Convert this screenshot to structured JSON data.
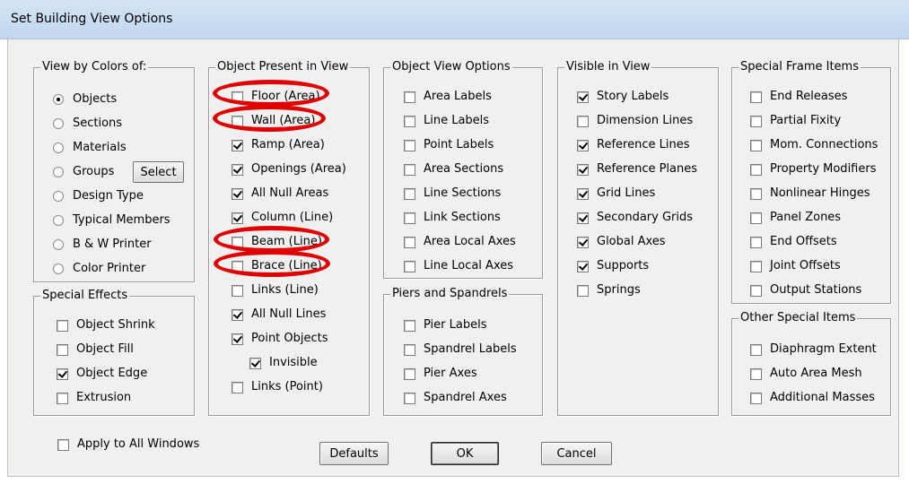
{
  "window": {
    "title": "Set Building View Options"
  },
  "view_by_colors": {
    "title": "View by Colors of:",
    "options": [
      {
        "label": "Objects",
        "selected": true
      },
      {
        "label": "Sections",
        "selected": false
      },
      {
        "label": "Materials",
        "selected": false
      },
      {
        "label": "Groups",
        "selected": false
      },
      {
        "label": "Design Type",
        "selected": false
      },
      {
        "label": "Typical Members",
        "selected": false
      },
      {
        "label": "B & W Printer",
        "selected": false
      },
      {
        "label": "Color Printer",
        "selected": false
      }
    ],
    "select_label": "Select"
  },
  "special_effects": {
    "title": "Special Effects",
    "items": [
      {
        "label": "Object Shrink",
        "checked": false
      },
      {
        "label": "Object Fill",
        "checked": false
      },
      {
        "label": "Object Edge",
        "checked": true
      },
      {
        "label": "Extrusion",
        "checked": false
      }
    ]
  },
  "object_present": {
    "title": "Object Present in View",
    "items": [
      {
        "label": "Floor (Area)",
        "checked": false,
        "circled": true
      },
      {
        "label": "Wall (Area)",
        "checked": false,
        "circled": true
      },
      {
        "label": "Ramp (Area)",
        "checked": true,
        "circled": false
      },
      {
        "label": "Openings (Area)",
        "checked": true,
        "circled": false
      },
      {
        "label": "All Null Areas",
        "checked": true,
        "circled": false
      },
      {
        "label": "Column (Line)",
        "checked": true,
        "circled": false
      },
      {
        "label": "Beam (Line)",
        "checked": false,
        "circled": true
      },
      {
        "label": "Brace (Line)",
        "checked": false,
        "circled": true
      },
      {
        "label": "Links (Line)",
        "checked": false,
        "circled": false
      },
      {
        "label": "All Null Lines",
        "checked": true,
        "circled": false
      },
      {
        "label": "Point Objects",
        "checked": true,
        "circled": false
      },
      {
        "label": "Invisible",
        "checked": true,
        "circled": false,
        "indent": true
      },
      {
        "label": "Links (Point)",
        "checked": false,
        "circled": false
      }
    ]
  },
  "object_view_options": {
    "title": "Object View Options",
    "items": [
      {
        "label": "Area Labels",
        "checked": false
      },
      {
        "label": "Line Labels",
        "checked": false
      },
      {
        "label": "Point Labels",
        "checked": false
      },
      {
        "label": "Area Sections",
        "checked": false
      },
      {
        "label": "Line Sections",
        "checked": false
      },
      {
        "label": "Link Sections",
        "checked": false
      },
      {
        "label": "Area Local Axes",
        "checked": false
      },
      {
        "label": "Line Local Axes",
        "checked": false
      }
    ]
  },
  "piers_spandrels": {
    "title": "Piers and Spandrels",
    "items": [
      {
        "label": "Pier Labels",
        "checked": false
      },
      {
        "label": "Spandrel Labels",
        "checked": false
      },
      {
        "label": "Pier Axes",
        "checked": false
      },
      {
        "label": "Spandrel Axes",
        "checked": false
      }
    ]
  },
  "visible_in_view": {
    "title": "Visible in View",
    "items": [
      {
        "label": "Story Labels",
        "checked": true
      },
      {
        "label": "Dimension Lines",
        "checked": false
      },
      {
        "label": "Reference Lines",
        "checked": true
      },
      {
        "label": "Reference Planes",
        "checked": true
      },
      {
        "label": "Grid Lines",
        "checked": true
      },
      {
        "label": "Secondary Grids",
        "checked": true
      },
      {
        "label": "Global Axes",
        "checked": true
      },
      {
        "label": "Supports",
        "checked": true
      },
      {
        "label": "Springs",
        "checked": false
      }
    ]
  },
  "special_frame_items": {
    "title": "Special Frame Items",
    "items": [
      {
        "label": "End Releases",
        "checked": false
      },
      {
        "label": "Partial Fixity",
        "checked": false
      },
      {
        "label": "Mom. Connections",
        "checked": false
      },
      {
        "label": "Property Modifiers",
        "checked": false
      },
      {
        "label": "Nonlinear Hinges",
        "checked": false
      },
      {
        "label": "Panel Zones",
        "checked": false
      },
      {
        "label": "End Offsets",
        "checked": false
      },
      {
        "label": "Joint Offsets",
        "checked": false
      },
      {
        "label": "Output Stations",
        "checked": false
      }
    ]
  },
  "other_special_items": {
    "title": "Other Special Items",
    "items": [
      {
        "label": "Diaphragm Extent",
        "checked": false
      },
      {
        "label": "Auto Area Mesh",
        "checked": false
      },
      {
        "label": "Additional Masses",
        "checked": false
      }
    ]
  },
  "apply_all": {
    "label": "Apply to All Windows",
    "checked": false
  },
  "buttons": {
    "defaults": "Defaults",
    "ok": "OK",
    "cancel": "Cancel"
  },
  "colors": {
    "highlight_ring": "#e00000",
    "title_bar": "#c8dcf2",
    "dialog_bg": "#f0f0f0"
  }
}
